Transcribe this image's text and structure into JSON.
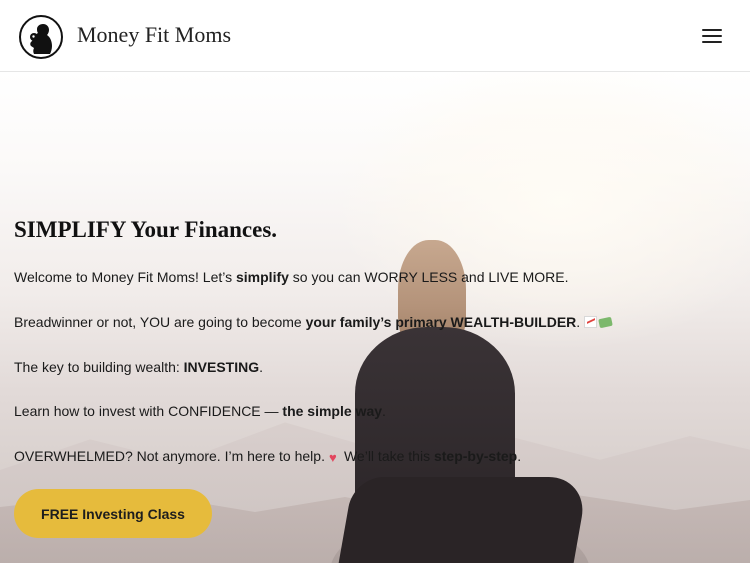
{
  "header": {
    "site_title": "Money Fit Moms",
    "logo_icon": "mom-silhouette-logo-icon",
    "menu_icon": "hamburger-menu-icon"
  },
  "hero": {
    "title": "SIMPLIFY Your Finances.",
    "paragraphs": {
      "p1": {
        "a": "Welcome to Money Fit Moms! Let’s ",
        "b": "simplify",
        "c": " so you can WORRY LESS and LIVE MORE."
      },
      "p2": {
        "a": "Breadwinner or not, YOU are going to become ",
        "b": "your family’s primary WEALTH-BUILDER",
        "c": "."
      },
      "p3": {
        "a": "The key to building wealth: ",
        "b": "INVESTING",
        "c": "."
      },
      "p4": {
        "a": "Learn how to invest with CONFIDENCE — ",
        "b": "the simple way",
        "c": "."
      },
      "p5": {
        "a": "OVERWHELMED? Not anymore. I’m here to help.",
        "heart": "♥",
        "b_pre": "We’ll take this ",
        "b": "step-by-step",
        "c": "."
      }
    },
    "emoji_icons": [
      "chart-increasing-icon",
      "money-with-wings-icon",
      "heart-icon"
    ],
    "cta_label": "FREE Investing Class"
  },
  "colors": {
    "cta_background": "#e6bb3c",
    "text": "#111111",
    "header_background": "#ffffff"
  }
}
